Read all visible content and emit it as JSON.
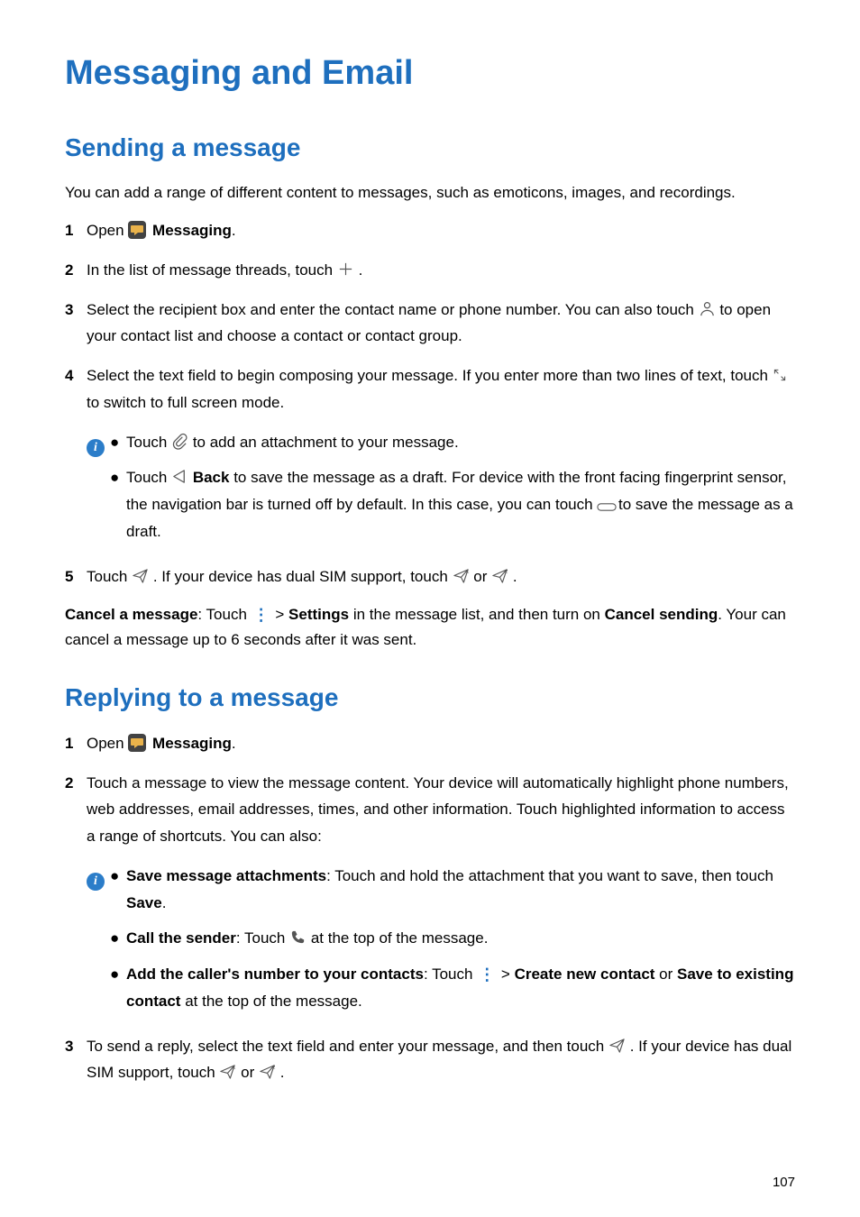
{
  "title": "Messaging and Email",
  "section1": {
    "heading": "Sending a message",
    "intro": "You can add a range of different content to messages, such as emoticons, images, and recordings.",
    "step1_pre": "Open ",
    "step1_bold": "Messaging",
    "step1_post": ".",
    "step2_pre": "In the list of message threads, touch ",
    "step2_post": " .",
    "step3_pre": "Select the recipient box and enter the contact name or phone number. You can also touch ",
    "step3_post": " to open your contact list and choose a contact or contact group.",
    "step4_pre": "Select the text field to begin composing your message. If you enter more than two lines of text, touch ",
    "step4_post": " to switch to full screen mode.",
    "note1_pre": "Touch ",
    "note1_post": " to add an attachment to your message.",
    "note2_pre": "Touch ",
    "note2_back": "Back",
    "note2_mid": " to save the message as a draft. For device with the front facing fingerprint sensor, the navigation bar is turned off by default. In this case, you can touch ",
    "note2_post": " to save the message as a draft.",
    "step5_pre": "Touch ",
    "step5_mid": " . If your device has dual SIM support, touch ",
    "step5_or": " or ",
    "step5_post": " .",
    "cancel_bold1": "Cancel a message",
    "cancel_mid1": ": Touch ",
    "cancel_mid2": " > ",
    "cancel_bold2": "Settings",
    "cancel_mid3": " in the message list, and then turn on ",
    "cancel_bold3": "Cancel sending",
    "cancel_post": ". Your can cancel a message up to 6 seconds after it was sent."
  },
  "section2": {
    "heading": "Replying to a message",
    "step1_pre": "Open ",
    "step1_bold": "Messaging",
    "step1_post": ".",
    "step2": "Touch a message to view the message content. Your device will automatically highlight phone numbers, web addresses, email addresses, times, and other information. Touch highlighted information to access a range of shortcuts. You can also:",
    "b1_bold": "Save message attachments",
    "b1_mid": ": Touch and hold the attachment that you want to save, then touch ",
    "b1_bold2": "Save",
    "b1_post": ".",
    "b2_bold": "Call the sender",
    "b2_mid": ": Touch ",
    "b2_post": " at the top of the message.",
    "b3_bold": "Add the caller's number to your contacts",
    "b3_mid": ": Touch ",
    "b3_mid2": " > ",
    "b3_bold2": "Create new contact",
    "b3_or": " or ",
    "b3_bold3": "Save to existing contact",
    "b3_post": " at the top of the message.",
    "step3_pre": "To send a reply, select the text field and enter your message, and then touch ",
    "step3_mid": " . If your device has dual SIM support, touch ",
    "step3_or": " or ",
    "step3_post": " ."
  },
  "pageNumber": "107"
}
